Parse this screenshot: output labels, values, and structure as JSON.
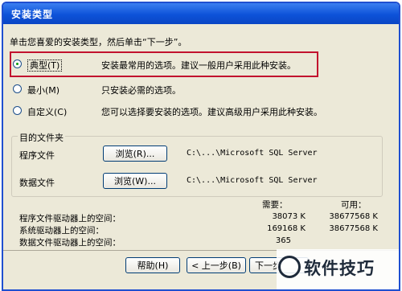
{
  "window": {
    "title": "安装类型"
  },
  "instruction": "单击您喜爱的安装类型，然后单击“下一步”。",
  "options": [
    {
      "label": "典型(T)",
      "description": "安装最常用的选项。建议一般用户采用此种安装。",
      "selected": true
    },
    {
      "label": "最小(M)",
      "description": "只安装必需的选项。",
      "selected": false
    },
    {
      "label": "自定义(C)",
      "description": "您可以选择要安装的选项。建议高级用户采用此种安装。",
      "selected": false
    }
  ],
  "destination": {
    "group_label": "目的文件夹",
    "program_files": {
      "label": "程序文件",
      "browse": "浏览(R)...",
      "path": "C:\\...\\Microsoft SQL Server"
    },
    "data_files": {
      "label": "数据文件",
      "browse": "浏览(W)...",
      "path": "C:\\...\\Microsoft SQL Server"
    }
  },
  "space": {
    "required_header": "需要：",
    "available_header": "可用：",
    "rows": [
      {
        "label": "程序文件驱动器上的空间：",
        "required": "38073 K",
        "available": "38677568 K"
      },
      {
        "label": "系统驱动器上的空间：",
        "required": "169168 K",
        "available": "38677568 K"
      },
      {
        "label": "数据文件驱动器上的空间：",
        "required": "365",
        "available": ""
      }
    ]
  },
  "buttons": {
    "help": "帮助(H)",
    "back": "< 上一步(B)",
    "next": "下一步"
  },
  "watermark": "软件技巧",
  "colors": {
    "title_bar": "#0d52d9",
    "highlight_box": "#c2122e",
    "dialog_bg": "#ece9d8"
  }
}
